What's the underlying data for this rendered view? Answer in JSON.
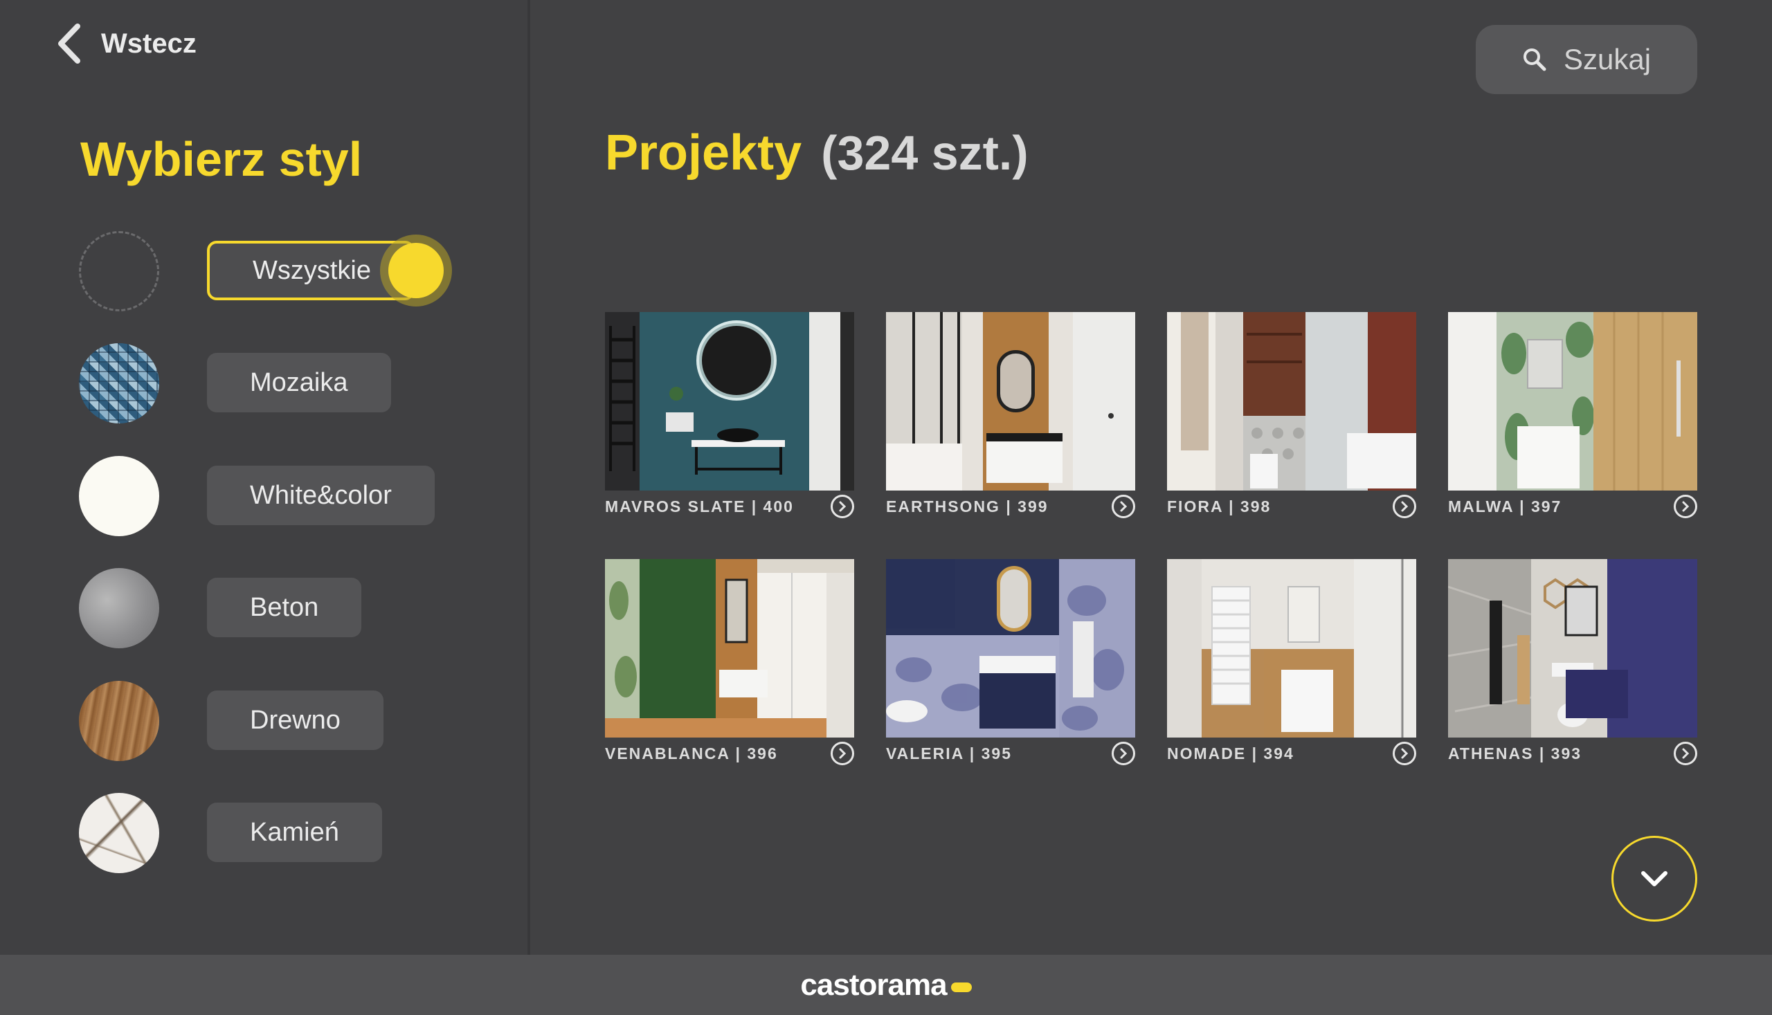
{
  "back": {
    "label": "Wstecz",
    "icon": "chevron-left-icon"
  },
  "sidebar": {
    "title": "Wybierz styl",
    "accent_color": "#f7d92d",
    "styles": [
      {
        "label": "Wszystkie",
        "selected": true,
        "swatch": "empty"
      },
      {
        "label": "Mozaika",
        "selected": false,
        "swatch": "blue mosaic"
      },
      {
        "label": "White&color",
        "selected": false,
        "swatch": "white"
      },
      {
        "label": "Beton",
        "selected": false,
        "swatch": "grey concrete"
      },
      {
        "label": "Drewno",
        "selected": false,
        "swatch": "wood"
      },
      {
        "label": "Kamień",
        "selected": false,
        "swatch": "white marble"
      }
    ]
  },
  "search": {
    "label": "Szukaj",
    "icon": "search-icon"
  },
  "main": {
    "title": "Projekty",
    "count": "(324 szt.)",
    "projects": [
      {
        "label": "MAVROS SLATE | 400"
      },
      {
        "label": "EARTHSONG | 399"
      },
      {
        "label": "FIORA | 398"
      },
      {
        "label": "MALWA | 397"
      },
      {
        "label": "VENABLANCA | 396"
      },
      {
        "label": "VALERIA | 395"
      },
      {
        "label": "NOMADE | 394"
      },
      {
        "label": "ATHENAS | 393"
      }
    ]
  },
  "scroll_down": {
    "icon": "chevron-down-icon"
  },
  "footer": {
    "brand": "castorama"
  }
}
